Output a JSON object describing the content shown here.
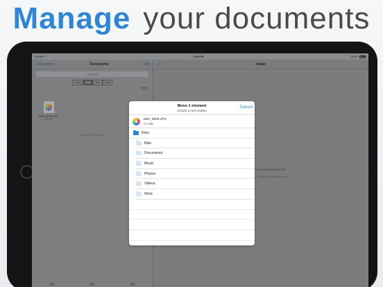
{
  "headline": {
    "accent": "Manage",
    "rest": "your documents"
  },
  "statusbar": {
    "carrier": "Carrier",
    "wifi_icon": "wifi-icon",
    "time": "1:40 PM",
    "battery": "100%"
  },
  "master": {
    "back_label": "Documents",
    "title": "Documents",
    "edit_label": "Edit",
    "search_placeholder": "Search",
    "sort_options": [
      "Name",
      "Date",
      "Size",
      "Type"
    ],
    "sort_selected": "Date",
    "file": {
      "name": "IMG_0003.JPG",
      "size": "2.4 MB"
    },
    "storage": "1 item, 176.05 GB free"
  },
  "detail": {
    "title": "Detail",
    "empty_title": "No document selected",
    "empty_sub": "Select a document to view"
  },
  "modal": {
    "title": "Move 1 element",
    "subtitle": "Choose a new location",
    "cancel": "Cancel",
    "file_name": "IMG_0003.JPG",
    "file_size": "2.4 MB",
    "root_folder": "Files",
    "folders": [
      "Bike",
      "Documents",
      "Music",
      "Photos",
      "Videos",
      "Work"
    ]
  },
  "colors": {
    "accent": "#2f86d6",
    "folder_light": "#d5e6f9"
  }
}
